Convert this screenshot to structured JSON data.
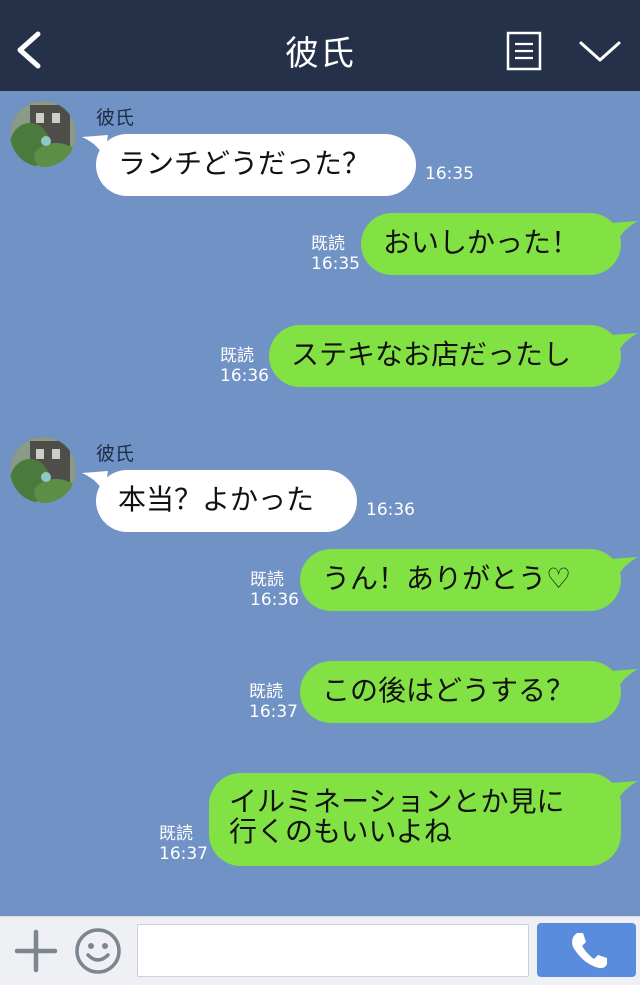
{
  "header": {
    "title": "彼氏",
    "back_icon": "chevron-left-icon",
    "notes_icon": "notes-icon",
    "menu_icon": "chevron-down-icon"
  },
  "colors": {
    "header_bg": "#243149",
    "chat_bg": "#7192c4",
    "outgoing_bubble": "#82e244",
    "incoming_bubble": "#ffffff",
    "call_button": "#5a8cde"
  },
  "messages": [
    {
      "direction": "in",
      "sender": "彼氏",
      "text": "ランチどうだった？",
      "time": "16:35"
    },
    {
      "direction": "out",
      "read": "既読",
      "text": "おいしかった！",
      "time": "16:35"
    },
    {
      "direction": "out",
      "read": "既読",
      "text": "ステキなお店だったし",
      "time": "16:36"
    },
    {
      "direction": "in",
      "sender": "彼氏",
      "text": "本当？よかった",
      "time": "16:36"
    },
    {
      "direction": "out",
      "read": "既読",
      "text": "うん！ありがとう♡",
      "time": "16:36"
    },
    {
      "direction": "out",
      "read": "既読",
      "text": "この後はどうする？",
      "time": "16:37"
    },
    {
      "direction": "out",
      "read": "既読",
      "text_line1": "イルミネーションとか見に",
      "text_line2": "行くのもいいよね",
      "time": "16:37"
    }
  ],
  "footer": {
    "plus_icon": "plus-icon",
    "emoji_icon": "smiley-icon",
    "input_value": "",
    "call_icon": "phone-icon"
  }
}
